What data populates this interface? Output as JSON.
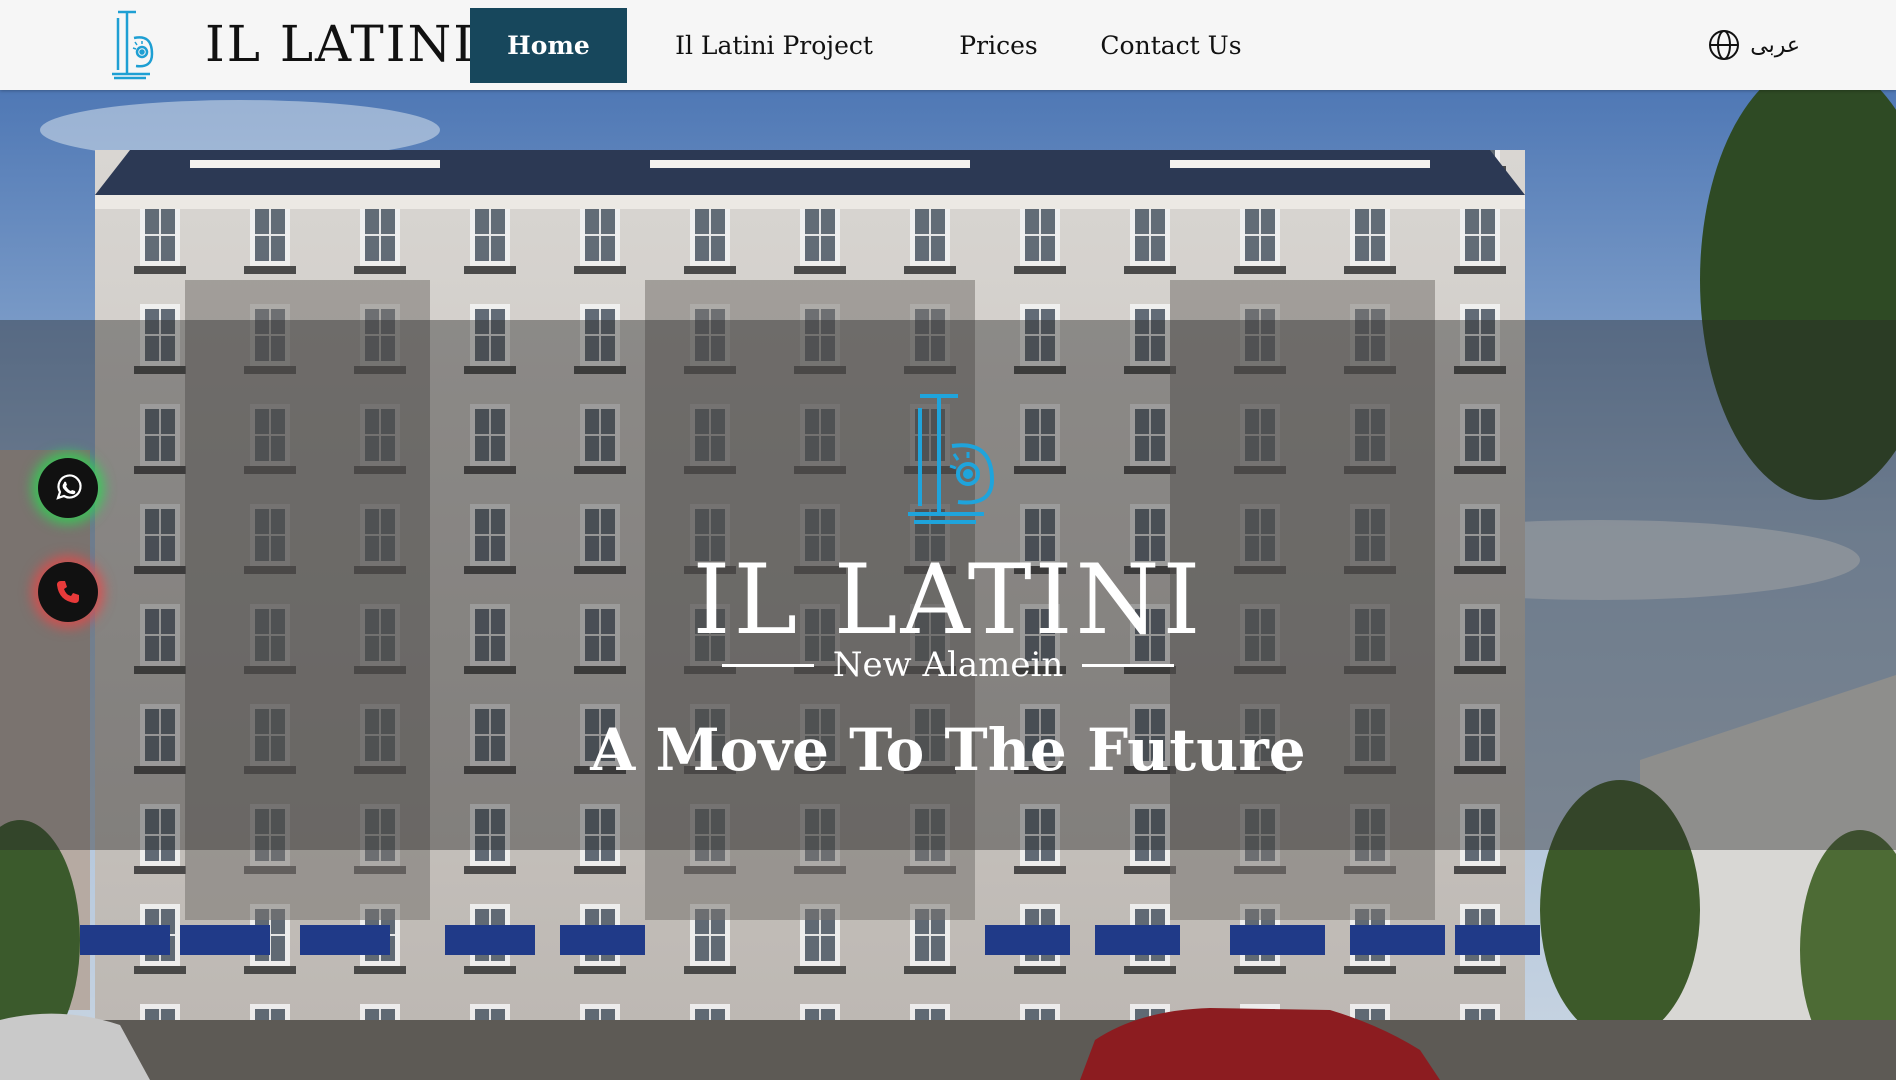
{
  "header": {
    "brand": "IL LATINI",
    "nav": {
      "home": "Home",
      "project": "Il Latini Project",
      "prices": "Prices",
      "contact": "Contact Us"
    },
    "language_label": "عربى"
  },
  "hero": {
    "brand_title": "IL LATINI",
    "subtitle": "New Alamein",
    "tagline": "A Move To The Future"
  },
  "colors": {
    "active_nav": "#17475c",
    "logo_accent": "#1e9fd3",
    "whatsapp_glow": "#28dc50",
    "phone_glow": "#eb4646"
  }
}
